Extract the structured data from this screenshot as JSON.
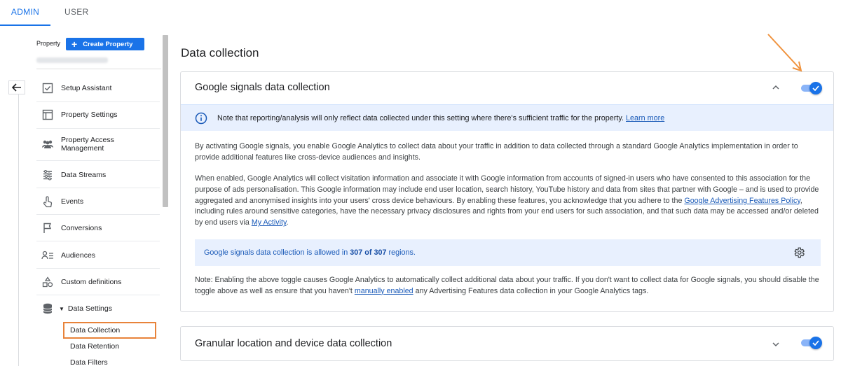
{
  "tabs": {
    "admin": "ADMIN",
    "user": "USER"
  },
  "sidebar": {
    "property_label": "Property",
    "create_property": "Create Property",
    "items": [
      {
        "label": "Setup Assistant",
        "icon": "checkbox-icon"
      },
      {
        "label": "Property Settings",
        "icon": "window-icon"
      },
      {
        "label": "Property Access\nManagement",
        "icon": "people-icon"
      },
      {
        "label": "Data Streams",
        "icon": "streams-icon"
      },
      {
        "label": "Events",
        "icon": "touch-icon"
      },
      {
        "label": "Conversions",
        "icon": "flag-icon"
      },
      {
        "label": "Audiences",
        "icon": "audience-icon"
      },
      {
        "label": "Custom definitions",
        "icon": "shapes-icon"
      },
      {
        "label": "Data Settings",
        "icon": "database-icon"
      }
    ],
    "sub_items": [
      "Data Collection",
      "Data Retention",
      "Data Filters"
    ]
  },
  "main": {
    "title": "Data collection",
    "signals_card": {
      "title": "Google signals data collection",
      "toggle_on": true,
      "notice_text": "Note that reporting/analysis will only reflect data collected under this setting where there's sufficient traffic for the property.",
      "notice_link": "Learn more",
      "para1": "By activating Google signals, you enable Google Analytics to collect data about your traffic in addition to data collected through a standard Google Analytics implementation in order to provide additional features like cross-device audiences and insights.",
      "para2_a": "When enabled, Google Analytics will collect visitation information and associate it with Google information from accounts of signed-in users who have consented to this association for the purpose of ads personalisation. This Google information may include end user location, search history, YouTube history and data from sites that partner with Google – and is used to provide aggregated and anonymised insights into your users' cross device behaviours. By enabling these features, you acknowledge that you adhere to the",
      "para2_link1": "Google Advertising Features Policy",
      "para2_b": ", including rules around sensitive categories, have the necessary privacy disclosures and rights from your end users for such association, and that such data may be accessed and/or deleted by end users via",
      "para2_link2": "My Activity",
      "para2_c": ".",
      "allowed_prefix": "Google signals data collection is allowed in",
      "allowed_count": "307 of 307",
      "allowed_suffix": "regions.",
      "note_a": "Note: Enabling the above toggle causes Google Analytics to automatically collect additional data about your traffic. If you don't want to collect data for Google signals, you should disable the toggle above as well as ensure that you haven't",
      "note_link": "manually enabled",
      "note_b": "any Advertising Features data collection in your Google Analytics tags."
    },
    "granular_card": {
      "title": "Granular location and device data collection",
      "toggle_on": true
    }
  },
  "colors": {
    "accent": "#1a73e8",
    "highlight": "#e8833a",
    "annotation_arrow": "#f0923c"
  }
}
